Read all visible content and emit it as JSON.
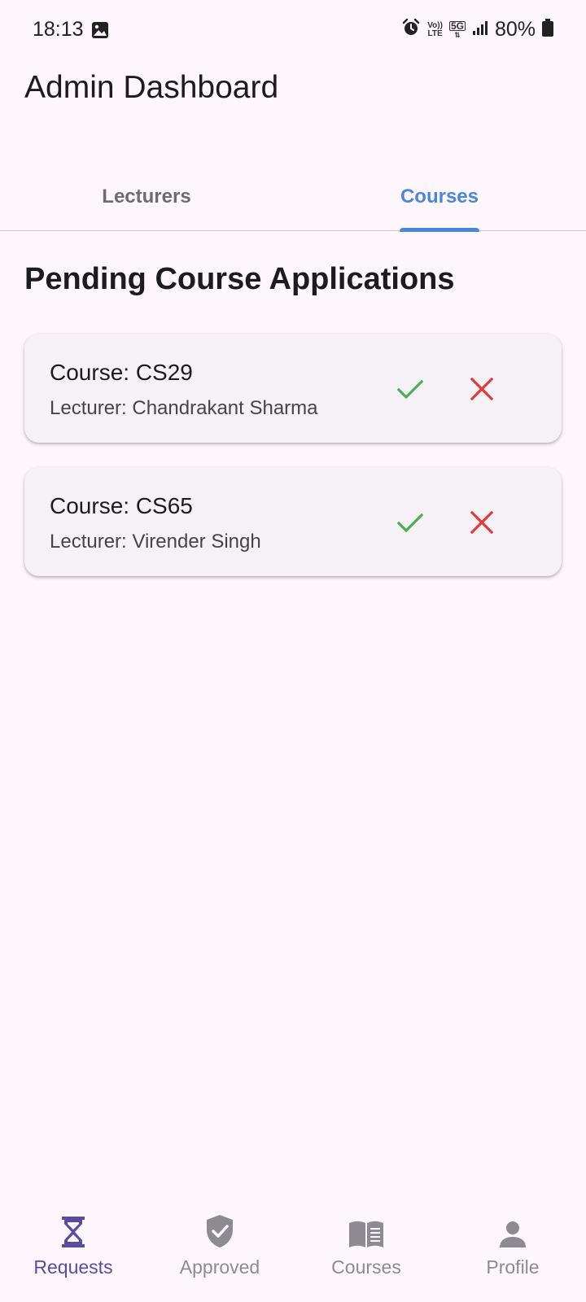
{
  "status_bar": {
    "time": "18:13",
    "volte_top": "Vo))",
    "volte_bottom": "LTE",
    "network": "5G",
    "battery": "80%",
    "icons": [
      "image-icon",
      "alarm-icon",
      "volte-icon",
      "5g-icon",
      "signal-icon",
      "battery-icon"
    ]
  },
  "app_bar": {
    "title": "Admin Dashboard"
  },
  "tabs": [
    {
      "label": "Lecturers",
      "active": false
    },
    {
      "label": "Courses",
      "active": true
    }
  ],
  "section": {
    "title": "Pending Course Applications"
  },
  "applications": [
    {
      "course": "Course: CS29",
      "lecturer": "Lecturer: Chandrakant Sharma"
    },
    {
      "course": "Course: CS65",
      "lecturer": "Lecturer: Virender Singh"
    }
  ],
  "bottom_nav": [
    {
      "label": "Requests",
      "icon": "hourglass-icon",
      "active": true
    },
    {
      "label": "Approved",
      "icon": "shield-check-icon",
      "active": false
    },
    {
      "label": "Courses",
      "icon": "book-icon",
      "active": false
    },
    {
      "label": "Profile",
      "icon": "person-icon",
      "active": false
    }
  ],
  "colors": {
    "background": "#fdf7fd",
    "accent_tab": "#4a86dc",
    "accent_nav": "#5b4b9e",
    "approve": "#4caf50",
    "reject": "#e53935",
    "card": "#f5f1f7"
  }
}
